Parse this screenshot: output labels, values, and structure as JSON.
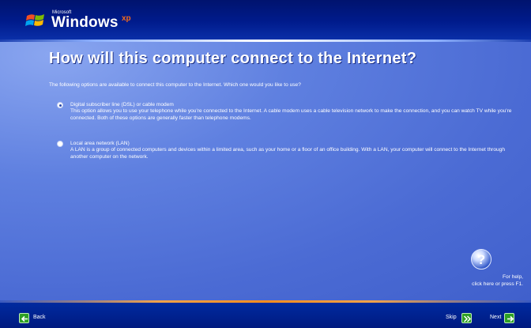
{
  "logo": {
    "small_text": "Microsoft",
    "word": "Windows",
    "superscript": "xp"
  },
  "page": {
    "title": "How will this computer connect to the Internet?",
    "intro": "The following options are available to connect this computer to the Internet. Which one would you like to use?"
  },
  "options": [
    {
      "label": "Digital subscriber line (DSL) or cable modem",
      "description": "This option allows you to use your telephone while you're connected to the Internet. A cable modem uses a cable television network to make the connection, and you can watch TV while you're connected. Both of these options are generally faster than telephone modems.",
      "selected": true
    },
    {
      "label": "Local area network (LAN)",
      "description": "A LAN is a group of connected computers and devices within a limited area, such as your home or a floor of an office building. With a LAN, your computer will connect to the Internet through another computer on the network.",
      "selected": false
    }
  ],
  "help": {
    "icon": "question-mark-icon",
    "line1": "For help,",
    "line2": "click here or press F1."
  },
  "footer": {
    "back_label": "Back",
    "skip_label": "Skip",
    "next_label": "Next"
  },
  "colors": {
    "header": "#001b8c",
    "main": "#5071d8",
    "footer": "#00228f",
    "accent_orange": "#ff8d1e",
    "arrow_green": "#2ea024"
  }
}
